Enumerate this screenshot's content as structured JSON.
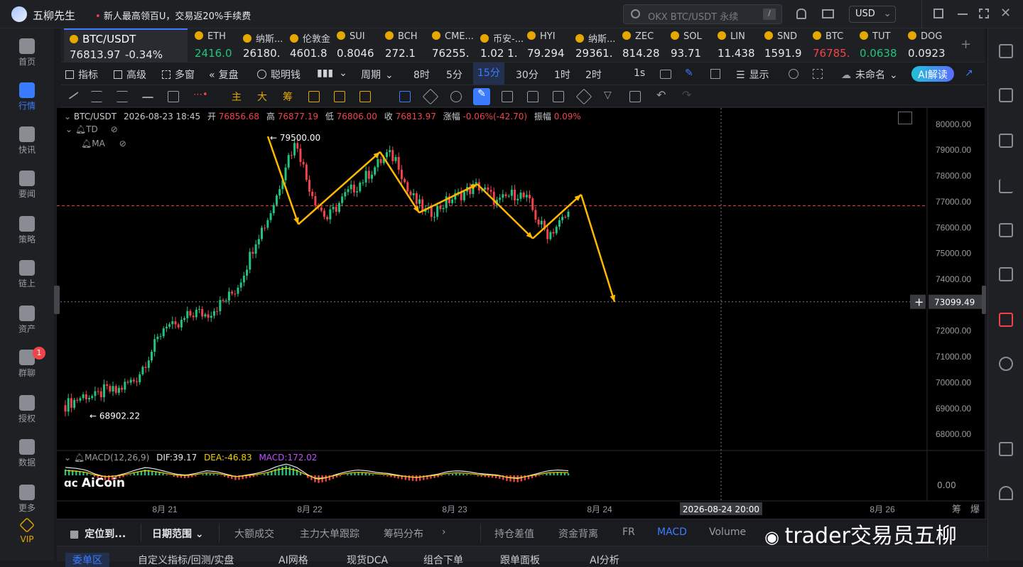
{
  "app": {
    "title": "五柳先生",
    "promo": "新人最高领百U，交易返20%手续费",
    "search_placeholder": "OKX BTC/USDT 永续",
    "search_key": "/",
    "currency": "USD"
  },
  "nav": [
    {
      "label": "首页",
      "icon": "ai-logo-icon"
    },
    {
      "label": "行情",
      "icon": "bar-chart-icon",
      "active": true
    },
    {
      "label": "快讯",
      "icon": "news-icon"
    },
    {
      "label": "要闻",
      "icon": "doc-icon"
    },
    {
      "label": "策略",
      "icon": "strategy-icon"
    },
    {
      "label": "链上",
      "icon": "chain-icon"
    },
    {
      "label": "资产",
      "icon": "wallet-icon"
    },
    {
      "label": "群聊",
      "icon": "chat-icon",
      "badge": "1"
    },
    {
      "label": "授权",
      "icon": "key-icon"
    },
    {
      "label": "数据",
      "icon": "data-icon"
    },
    {
      "label": "更多",
      "icon": "grid-icon"
    },
    {
      "label": "VIP",
      "icon": "vip-icon"
    }
  ],
  "tickers": [
    {
      "name": "BTC/USDT",
      "price": "76813.97",
      "change": "-0.34%",
      "color": "#e6e7ea",
      "active": true
    },
    {
      "name": "ETH",
      "price": "2416.0",
      "color": "#21c37e"
    },
    {
      "name": "纳斯...",
      "price": "26180.",
      "color": "#e6e7ea"
    },
    {
      "name": "伦敦金",
      "price": "4601.8",
      "color": "#e6e7ea"
    },
    {
      "name": "SUI",
      "price": "0.8046",
      "color": "#e6e7ea"
    },
    {
      "name": "BCH",
      "price": "272.1",
      "color": "#e6e7ea"
    },
    {
      "name": "CME...",
      "price": "76255.",
      "color": "#e6e7ea"
    },
    {
      "name": "币安-...",
      "price": "1.02 1.",
      "color": "#e6e7ea"
    },
    {
      "name": "HYI",
      "price": "79.294",
      "color": "#e6e7ea"
    },
    {
      "name": "纳斯...",
      "price": "29361.",
      "color": "#e6e7ea"
    },
    {
      "name": "ZEC",
      "price": "814.28",
      "color": "#e6e7ea"
    },
    {
      "name": "SOL",
      "price": "93.71",
      "color": "#e6e7ea"
    },
    {
      "name": "LIN",
      "price": "11.438",
      "color": "#e6e7ea"
    },
    {
      "name": "SND",
      "price": "1591.9",
      "color": "#e6e7ea"
    },
    {
      "name": "BTC",
      "price": "76785.",
      "color": "#f0434a"
    },
    {
      "name": "TUT",
      "price": "0.0638",
      "color": "#21c37e"
    },
    {
      "name": "DOG",
      "price": "0.0923",
      "color": "#e6e7ea"
    }
  ],
  "toolbar": {
    "indicators": "指标",
    "advanced": "高级",
    "multi_window": "多窗",
    "replay": "复盘",
    "smart_money": "聪明钱",
    "period": "周期",
    "intervals": [
      "8时",
      "5分",
      "15分",
      "30分",
      "1时",
      "2时"
    ],
    "active_interval": "15分",
    "one_second": "1s",
    "display": "显示",
    "layout_name": "未命名",
    "ai_button": "AI解读"
  },
  "drawbar": {
    "main": "主",
    "big": "大",
    "chips": "筹"
  },
  "legend": {
    "symbol": "BTC/USDT",
    "datetime": "2026-08-23 18:45",
    "open_label": "开",
    "open": "76856.68",
    "high_label": "高",
    "high": "76877.19",
    "low_label": "低",
    "low": "76806.00",
    "close_label": "收",
    "close": "76813.97",
    "chg_label": "涨幅",
    "chg": "-0.06%(-42.70)",
    "amp_label": "振幅",
    "amp": "0.09%",
    "td": "TD",
    "ma": "MA"
  },
  "macd_legend": {
    "name": "MACD(12,26,9)",
    "dif": "DIF:39.17",
    "dea": "DEA:-46.83",
    "macd": "MACD:172.02"
  },
  "chart_data": {
    "type": "candlestick",
    "yticks": [
      "80000.00",
      "79000.00",
      "78000.00",
      "77000.00",
      "76000.00",
      "75000.00",
      "74000.00",
      "73000.00",
      "72000.00",
      "71000.00",
      "70000.00",
      "69000.00",
      "68000.00"
    ],
    "ylim": [
      67400,
      80600
    ],
    "xticks": [
      "8月 21",
      "8月 22",
      "8月 23",
      "8月 24",
      "8月 26"
    ],
    "crosshair_price": "73099.49",
    "crosshair_date": "2026-08-24 20:00",
    "price_line": 76813.97,
    "high_label": "79500.00",
    "low_label": "68902.22",
    "macd_zero": "0.00",
    "path_prices": [
      79500,
      76100,
      78900,
      76550,
      77650,
      75550,
      77250,
      73100
    ],
    "close_series": [
      69100,
      69300,
      69500,
      69400,
      69700,
      69600,
      69900,
      70100,
      70800,
      71500,
      72300,
      72000,
      72500,
      72700,
      72600,
      72900,
      73200,
      73600,
      74500,
      75600,
      76200,
      77200,
      78600,
      79300,
      77800,
      76900,
      76300,
      76800,
      77300,
      77600,
      78000,
      78400,
      78800,
      78600,
      77400,
      76900,
      76500,
      76700,
      77000,
      77200,
      77400,
      77600,
      77300,
      76900,
      77200,
      77300,
      77000,
      76200,
      75700,
      76100,
      76500
    ],
    "macd_values": [
      0.6,
      0.5,
      0.3,
      -0.2,
      -0.5,
      -0.4,
      -0.1,
      0.3,
      0.6,
      0.4,
      0.1,
      -0.2,
      -0.3,
      -0.1,
      0.2,
      0.1,
      -0.2,
      -0.5,
      -0.3,
      -0.1,
      0.2,
      0.7,
      1.0,
      0.6,
      -0.2,
      -0.8,
      -0.6,
      -0.2,
      0.1,
      0.3,
      0.2,
      0.0,
      -0.1,
      -0.3,
      -0.5,
      -0.6,
      -0.4,
      -0.2,
      0.1,
      0.2,
      0.1,
      -0.1,
      -0.2,
      -0.3,
      -0.6,
      -0.7,
      -0.4,
      -0.1,
      0.2,
      0.3,
      0.2
    ]
  },
  "watermark": {
    "logo": "AiCoin",
    "weibo": "trader交易员五柳"
  },
  "bottombar": {
    "locate": "定位到...",
    "date_range": "日期范围",
    "items": [
      "大额成交",
      "主力大单跟踪",
      "筹码分布"
    ],
    "right_items": [
      "持仓差值",
      "资金背离",
      "FR",
      "MACD",
      "Volume"
    ],
    "active": "MACD"
  },
  "bottomtabs": [
    "委单区",
    "自定义指标/回测/实盘",
    "AI网格",
    "现货DCA",
    "组合下单",
    "跟单面板",
    "AI分析"
  ],
  "scale_labels": [
    "筹",
    "爆"
  ]
}
